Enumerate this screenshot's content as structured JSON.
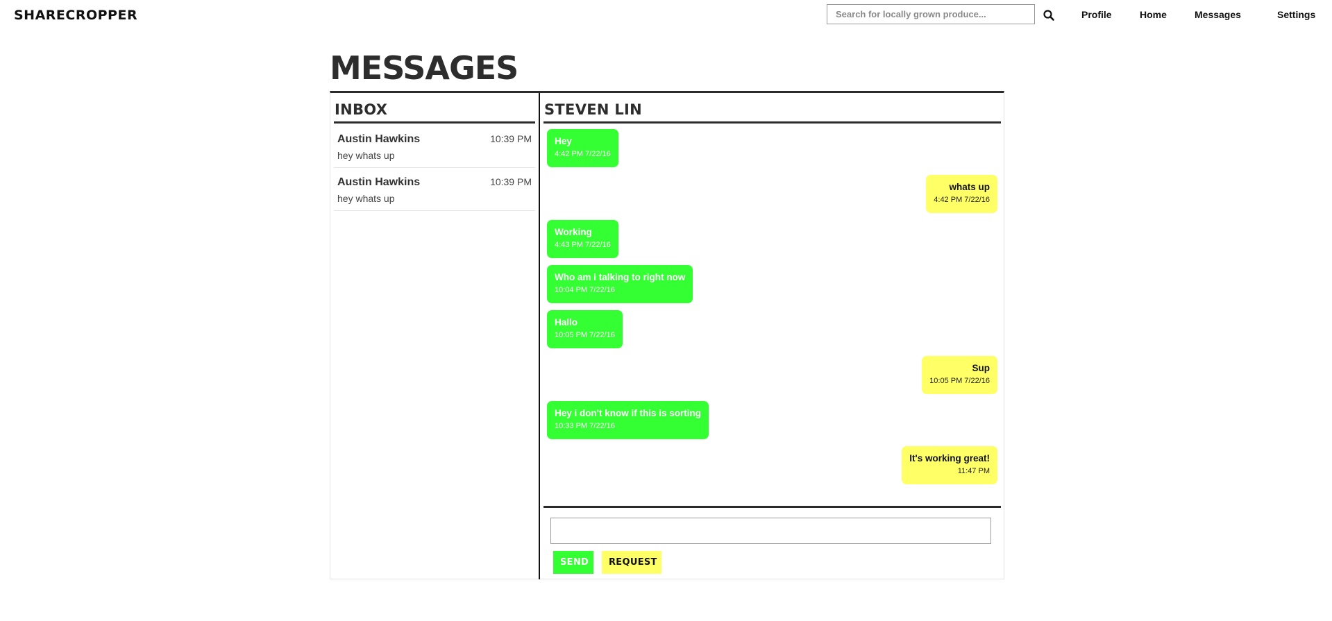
{
  "brand": "SHARECROPPER",
  "search": {
    "placeholder": "Search for locally grown produce...",
    "value": ""
  },
  "nav": {
    "profile": "Profile",
    "home": "Home",
    "messages": "Messages",
    "settings": "Settings"
  },
  "page_title": "MESSAGES",
  "inbox": {
    "heading": "INBOX",
    "items": [
      {
        "name": "Austin Hawkins",
        "time": "10:39 PM",
        "preview": "hey whats up"
      },
      {
        "name": "Austin Hawkins",
        "time": "10:39 PM",
        "preview": "hey whats up"
      }
    ]
  },
  "chat": {
    "contact": "STEVEN LIN",
    "messages": [
      {
        "direction": "in",
        "text": "Hey",
        "time": "4:42 PM 7/22/16"
      },
      {
        "direction": "out",
        "text": "whats up",
        "time": "4:42 PM 7/22/16"
      },
      {
        "direction": "in",
        "text": "Working",
        "time": "4:43 PM 7/22/16"
      },
      {
        "direction": "in",
        "text": "Who am i talking to right now",
        "time": "10:04 PM 7/22/16"
      },
      {
        "direction": "in",
        "text": "Hallo",
        "time": "10:05 PM 7/22/16"
      },
      {
        "direction": "out",
        "text": "Sup",
        "time": "10:05 PM 7/22/16"
      },
      {
        "direction": "in",
        "text": "Hey i don't know if this is sorting",
        "time": "10:33 PM 7/22/16"
      },
      {
        "direction": "out",
        "text": "It's working great!",
        "time": "11:47 PM"
      }
    ]
  },
  "composer": {
    "value": "",
    "send_label": "SEND",
    "request_label": "REQUEST"
  },
  "colors": {
    "incoming": "#33ff33",
    "outgoing": "#ffff66",
    "rule": "#2b2b2b"
  },
  "icons": {
    "search": "search-icon"
  }
}
